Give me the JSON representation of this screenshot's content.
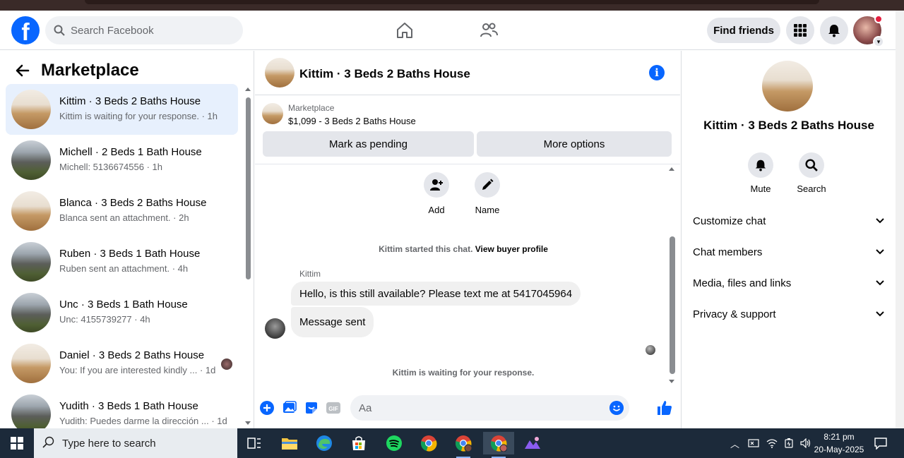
{
  "header": {
    "search_placeholder": "Search Facebook",
    "find_friends": "Find friends"
  },
  "sidebar": {
    "title": "Marketplace",
    "conversations": [
      {
        "name": "Kittim · 3 Beds 2 Baths House",
        "sub": "Kittim is waiting for your response. · 1h",
        "thumb": "room"
      },
      {
        "name": "Michell · 2 Beds 1 Bath House",
        "sub": "Michell: 5136674556 · 1h",
        "thumb": "house"
      },
      {
        "name": "Blanca · 3 Beds 2 Baths House",
        "sub": "Blanca sent an attachment. · 2h",
        "thumb": "room"
      },
      {
        "name": "Ruben · 3 Beds 1 Bath House",
        "sub": "Ruben sent an attachment. · 4h",
        "thumb": "house"
      },
      {
        "name": "Unc · 3 Beds 1 Bath House",
        "sub": "Unc: 4155739277 · 4h",
        "thumb": "house"
      },
      {
        "name": "Daniel · 3 Beds 2 Baths House",
        "sub": "You: If you are interested kindly ... · 1d",
        "thumb": "room"
      },
      {
        "name": "Yudith · 3 Beds 1 Bath House",
        "sub": "Yudith: Puedes darme la dirección ... · 1d",
        "thumb": "house"
      }
    ]
  },
  "chat": {
    "title": "Kittim · 3 Beds 2 Baths House",
    "listing_label": "Marketplace",
    "listing_price": "$1,099 - 3 Beds 2 Baths House",
    "mark_pending": "Mark as pending",
    "more_options": "More options",
    "add_label": "Add",
    "name_label": "Name",
    "started_text": "Kittim started this chat.",
    "view_buyer": "View buyer profile",
    "sender": "Kittim",
    "message1": "Hello, is this still available? Please text me at 5417045964",
    "message2": "Message sent",
    "waiting": "Kittim is waiting for your response.",
    "composer_placeholder": "Aa"
  },
  "details": {
    "name": "Kittim · 3 Beds 2 Baths House",
    "mute": "Mute",
    "search": "Search",
    "rows": [
      "Customize chat",
      "Chat members",
      "Media, files and links",
      "Privacy & support"
    ]
  },
  "taskbar": {
    "search_placeholder": "Type here to search",
    "time": "8:21 pm",
    "date": "20-May-2025"
  },
  "colors": {
    "accent": "#0866ff",
    "active_bg": "#e7f0fd",
    "button_bg": "#e4e6eb",
    "taskbar": "#1c2a3a"
  }
}
